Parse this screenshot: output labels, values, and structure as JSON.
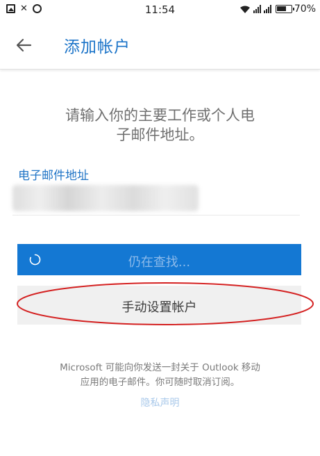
{
  "status_bar": {
    "time": "11:54",
    "battery": "70%",
    "battery_level": 0.7,
    "icons": [
      "gallery-icon",
      "mute-icon",
      "alarm-icon",
      "wifi-icon",
      "signal-icon",
      "battery-icon"
    ]
  },
  "app_bar": {
    "back_icon": "arrow-left-icon",
    "title": "添加帐户"
  },
  "main": {
    "headline_line1": "请输入你的主要工作或个人电",
    "headline_line2": "子邮件地址。",
    "email_label": "电子邮件地址",
    "primary_button": "仍在查找...",
    "secondary_button": "手动设置帐户",
    "disclaimer_line1": "Microsoft 可能向你发送一封关于 Outlook 移动",
    "disclaimer_line2": "应用的电子邮件。你可随时取消订阅。",
    "privacy_link": "隐私声明"
  },
  "colors": {
    "accent": "#1478d3",
    "title_blue": "#1a73c8",
    "annotation_red": "#d42020"
  }
}
